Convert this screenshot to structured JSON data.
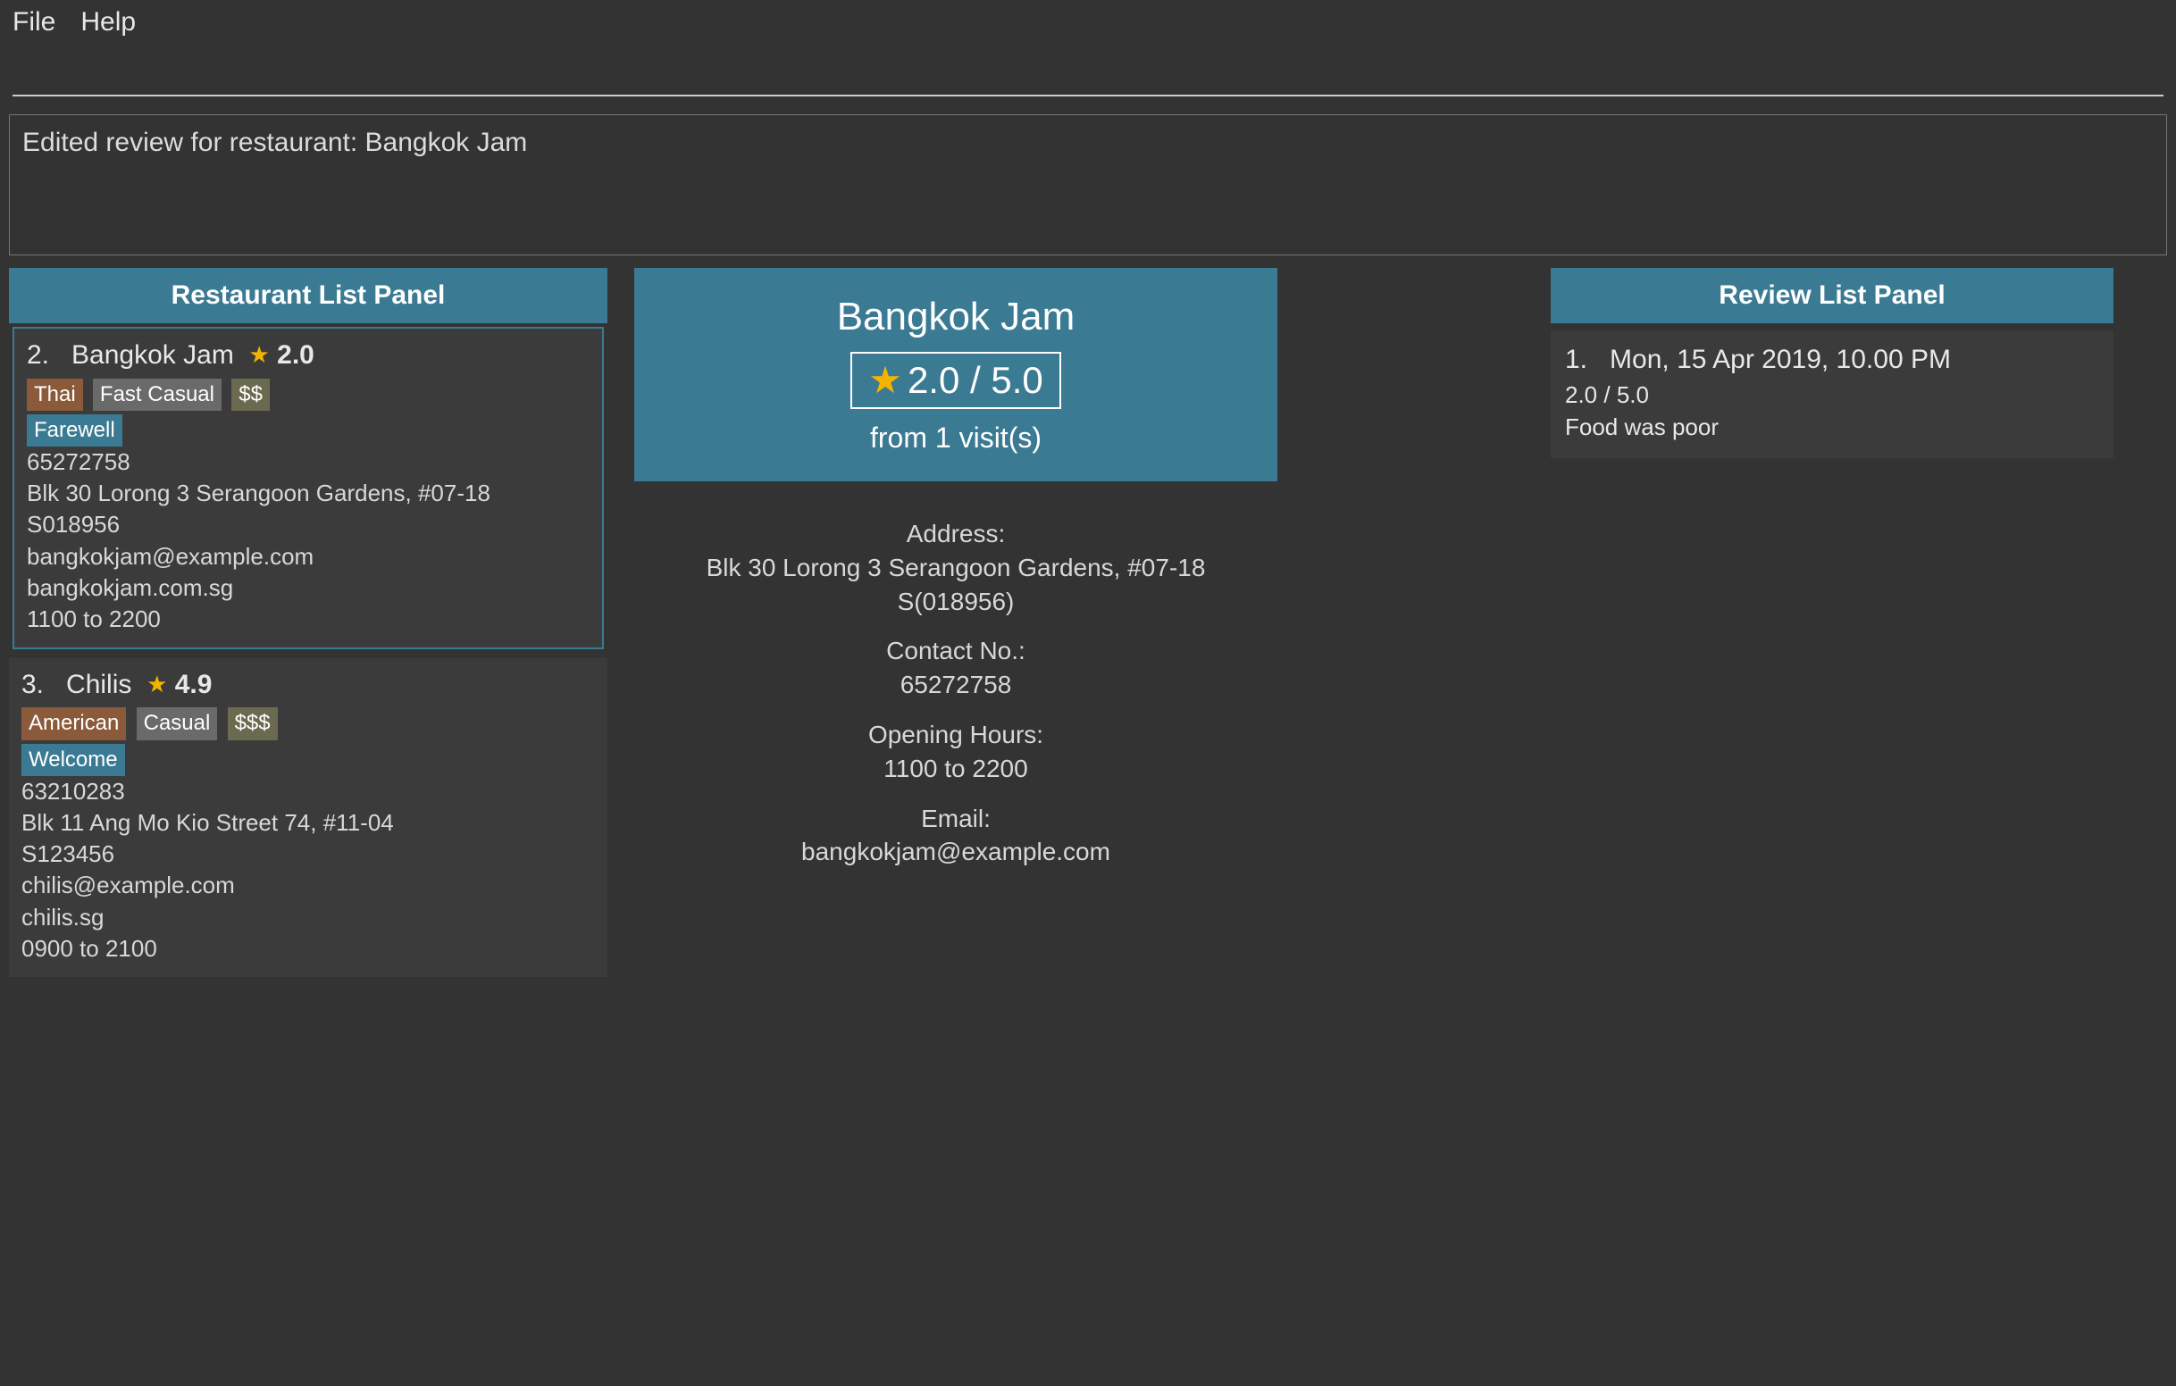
{
  "menu": {
    "file": "File",
    "help": "Help"
  },
  "command": {
    "value": ""
  },
  "status": {
    "message": "Edited review for restaurant: Bangkok Jam"
  },
  "left": {
    "header": "Restaurant List Panel",
    "items": [
      {
        "index": "2.",
        "name": "Bangkok Jam",
        "rating": "2.0",
        "cuisine": "Thai",
        "style": "Fast Casual",
        "price": "$$",
        "occasion": "Farewell",
        "phone": "65272758",
        "address": "Blk 30 Lorong 3 Serangoon Gardens, #07-18",
        "postal": "S018956",
        "email": "bangkokjam@example.com",
        "website": "bangkokjam.com.sg",
        "hours": "1100 to 2200",
        "selected": true
      },
      {
        "index": "3.",
        "name": "Chilis",
        "rating": "4.9",
        "cuisine": "American",
        "style": "Casual",
        "price": "$$$",
        "occasion": "Welcome",
        "phone": "63210283",
        "address": "Blk 11 Ang Mo Kio Street 74, #11-04",
        "postal": "S123456",
        "email": "chilis@example.com",
        "website": "chilis.sg",
        "hours": "0900 to 2100",
        "selected": false
      }
    ]
  },
  "detail": {
    "name": "Bangkok Jam",
    "rating": "2.0 / 5.0",
    "visits": "from 1 visit(s)",
    "address_label": "Address:",
    "address_line1": "Blk 30 Lorong 3 Serangoon Gardens, #07-18",
    "address_line2": "S(018956)",
    "contact_label": "Contact No.:",
    "contact": "65272758",
    "hours_label": "Opening Hours:",
    "hours": "1100 to 2200",
    "email_label": "Email:",
    "email": "bangkokjam@example.com"
  },
  "right": {
    "header": "Review List Panel",
    "reviews": [
      {
        "index": "1.",
        "date": "Mon, 15 Apr 2019, 10.00 PM",
        "rating": "2.0 / 5.0",
        "text": "Food was poor"
      }
    ]
  }
}
